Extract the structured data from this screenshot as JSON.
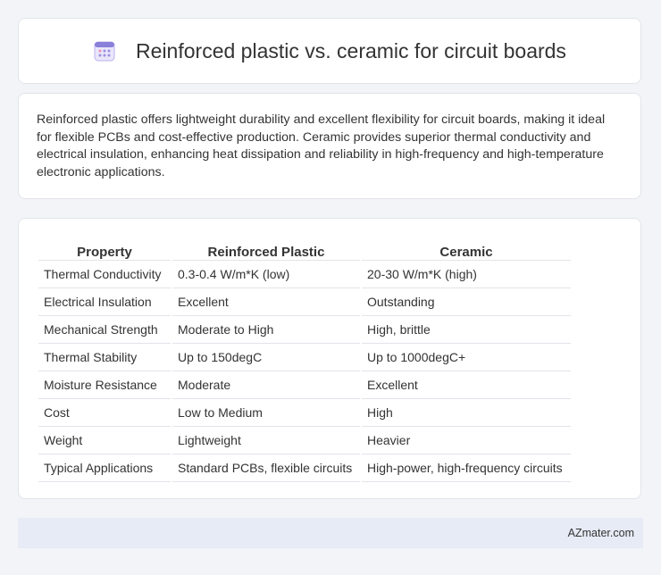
{
  "header": {
    "title": "Reinforced plastic vs. ceramic for circuit boards",
    "icon": "calendar-icon"
  },
  "summary": {
    "text": "Reinforced plastic offers lightweight durability and excellent flexibility for circuit boards, making it ideal for flexible PCBs and cost-effective production. Ceramic provides superior thermal conductivity and electrical insulation, enhancing heat dissipation and reliability in high-frequency and high-temperature electronic applications."
  },
  "table": {
    "columns": [
      "Property",
      "Reinforced Plastic",
      "Ceramic"
    ],
    "rows": [
      [
        "Thermal Conductivity",
        "0.3-0.4 W/m*K (low)",
        "20-30 W/m*K (high)"
      ],
      [
        "Electrical Insulation",
        "Excellent",
        "Outstanding"
      ],
      [
        "Mechanical Strength",
        "Moderate to High",
        "High, brittle"
      ],
      [
        "Thermal Stability",
        "Up to 150degC",
        "Up to 1000degC+"
      ],
      [
        "Moisture Resistance",
        "Moderate",
        "Excellent"
      ],
      [
        "Cost",
        "Low to Medium",
        "High"
      ],
      [
        "Weight",
        "Lightweight",
        "Heavier"
      ],
      [
        "Typical Applications",
        "Standard PCBs, flexible circuits",
        "High-power, high-frequency circuits"
      ]
    ]
  },
  "footer": {
    "text": "AZmater.com"
  },
  "colors": {
    "background": "#f3f4f8",
    "card": "#ffffff",
    "border": "#e2e4ea",
    "footer_bg": "#e6ebf5",
    "icon_accent": "#8a7fd9"
  }
}
